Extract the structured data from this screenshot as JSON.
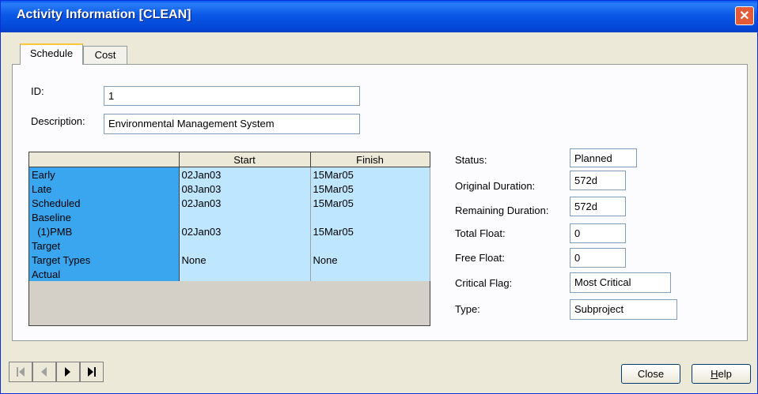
{
  "window": {
    "title": "Activity Information [CLEAN]"
  },
  "tabs": [
    {
      "label": "Schedule"
    },
    {
      "label": "Cost"
    }
  ],
  "form": {
    "id_label": "ID:",
    "id_value": "1",
    "description_label": "Description:",
    "description_value": "Environmental Management System"
  },
  "dates_table": {
    "columns": [
      "",
      "Start",
      "Finish"
    ],
    "rows": [
      {
        "label": "Early",
        "start": "02Jan03",
        "finish": "15Mar05"
      },
      {
        "label": "Late",
        "start": "08Jan03",
        "finish": "15Mar05"
      },
      {
        "label": "Scheduled",
        "start": "02Jan03",
        "finish": "15Mar05"
      },
      {
        "label": "Baseline",
        "start": "",
        "finish": ""
      },
      {
        "label": "  (1)PMB",
        "start": "02Jan03",
        "finish": "15Mar05"
      },
      {
        "label": "Target",
        "start": "",
        "finish": ""
      },
      {
        "label": "Target Types",
        "start": "None",
        "finish": "None"
      },
      {
        "label": "Actual",
        "start": "",
        "finish": ""
      }
    ]
  },
  "status": {
    "status_label": "Status:",
    "status_value": "Planned",
    "orig_dur_label": "Original Duration:",
    "orig_dur_value": "572d",
    "rem_dur_label": "Remaining Duration:",
    "rem_dur_value": "572d",
    "total_float_label": "Total Float:",
    "total_float_value": "0",
    "free_float_label": "Free Float:",
    "free_float_value": "0",
    "critical_label": "Critical Flag:",
    "critical_value": "Most Critical",
    "type_label": "Type:",
    "type_value": "Subproject"
  },
  "buttons": {
    "close": "Close",
    "help_first": "H",
    "help_rest": "elp"
  },
  "nav_icons": [
    "first-record-icon",
    "previous-record-icon",
    "next-record-icon",
    "last-record-icon"
  ],
  "colors": {
    "titlebar": "#0a58e6",
    "row_header": "#3aa6f0",
    "cell_bg": "#bfe6ff",
    "close_btn": "#e35a39"
  }
}
